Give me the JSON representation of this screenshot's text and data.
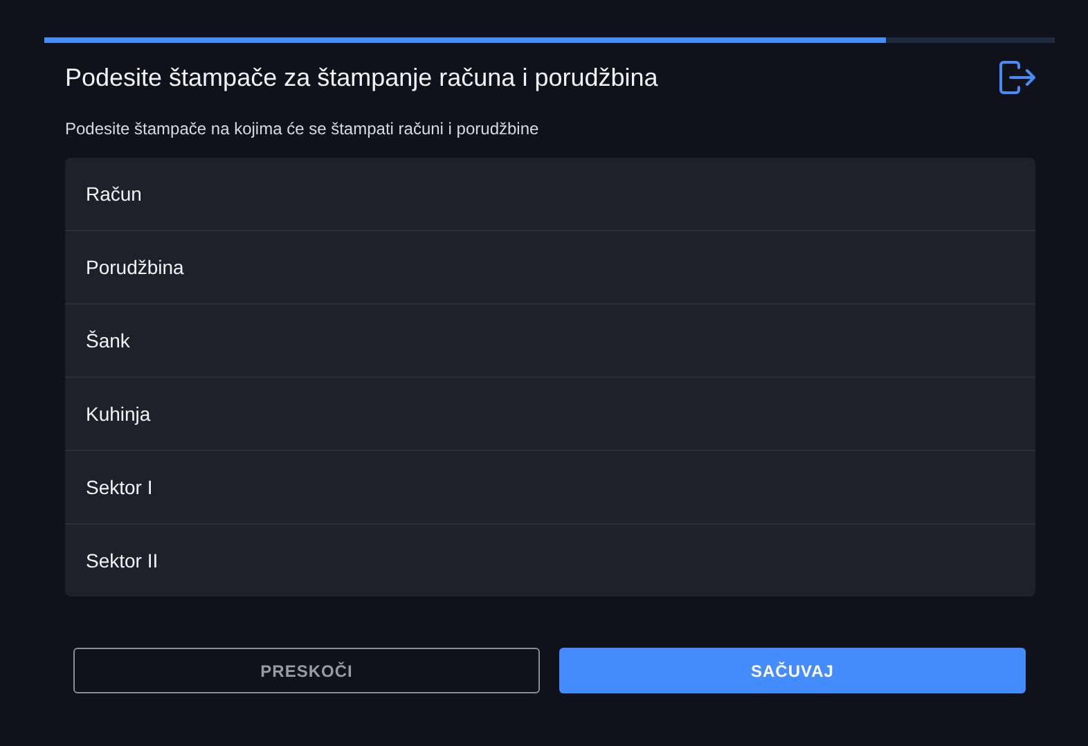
{
  "progress": {
    "level": 0.833
  },
  "title": "Podesite štampače za štampanje računa i porudžbina",
  "subtitle": "Podesite štampače na kojima će se štampati računi i porudžbine",
  "printers": [
    "Račun",
    "Porudžbina",
    "Šank",
    "Kuhinja",
    "Sektor I",
    "Sektor II"
  ],
  "buttons": [
    {
      "label": "PRESKOČI",
      "kind": "outline"
    },
    {
      "label": "SAČUVAJ",
      "kind": "primary"
    }
  ]
}
